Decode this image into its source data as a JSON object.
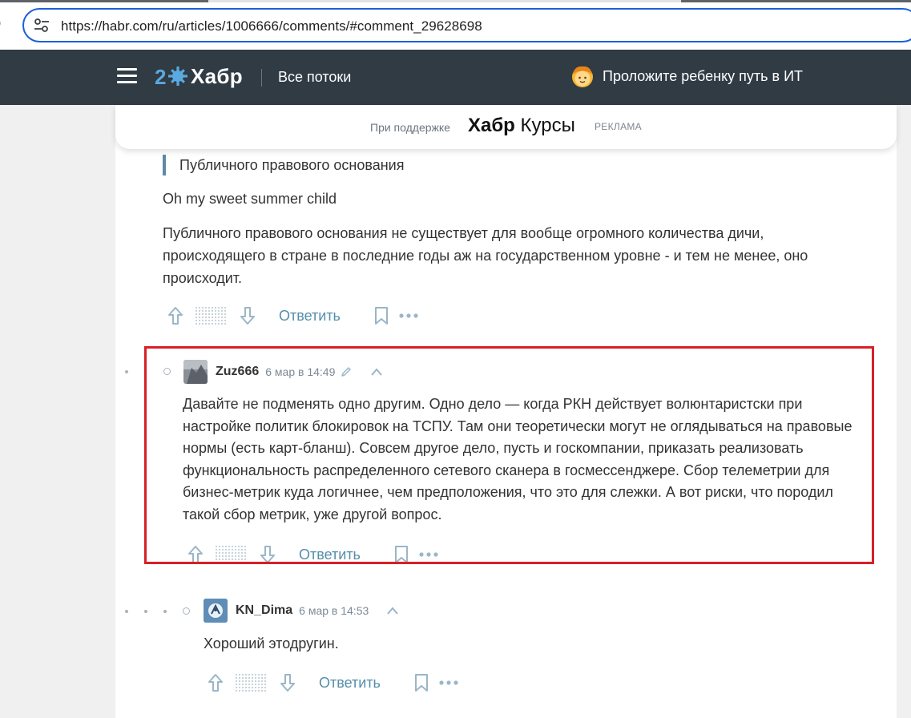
{
  "browser": {
    "url": "https://habr.com/ru/articles/1006666/comments/#comment_29628698"
  },
  "header": {
    "logo_text": "Хабр",
    "all_streams": "Все потоки",
    "promo_text": "Проложите ребенку путь в ИТ"
  },
  "sponsor": {
    "label": "При поддержке",
    "brand_bold": "Хабр",
    "brand_rest": "Курсы",
    "ad_label": "РЕКЛАМА"
  },
  "parent_comment": {
    "quote": "Публичного правового основания",
    "paragraph_1": "Oh my sweet summer child",
    "paragraph_2": "Публичного правового основания не существует для вообще огромного количества дичи, происходящего в стране в последние годы аж на государственном уровне - и тем не менее, оно происходит.",
    "reply_label": "Ответить"
  },
  "highlighted_comment": {
    "author": "Zuz666",
    "time": "6 мар в 14:49",
    "text": "Давайте не подменять одно другим. Одно дело — когда РКН действует волюнтаристски при настройке политик блокировок на ТСПУ. Там они теоретически могут не оглядываться на правовые нормы (есть карт-бланш). Совсем другое дело, пусть и госкомпании, приказать реализовать функциональность распределенного сетевого сканера в госмессенджере. Сбор телеметрии для бизнес-метрик куда логичнее, чем предположения, что это для слежки. А вот риски, что породил такой сбор метрик, уже другой вопрос.",
    "reply_label": "Ответить"
  },
  "reply_comment": {
    "author": "KN_Dima",
    "time": "6 мар в 14:53",
    "text": "Хороший этодругин.",
    "reply_label": "Ответить"
  },
  "colors": {
    "header_bg": "#303b44",
    "highlight_border": "#d91f27",
    "link_blue": "#548eaa",
    "url_focus": "#1a61d8"
  }
}
